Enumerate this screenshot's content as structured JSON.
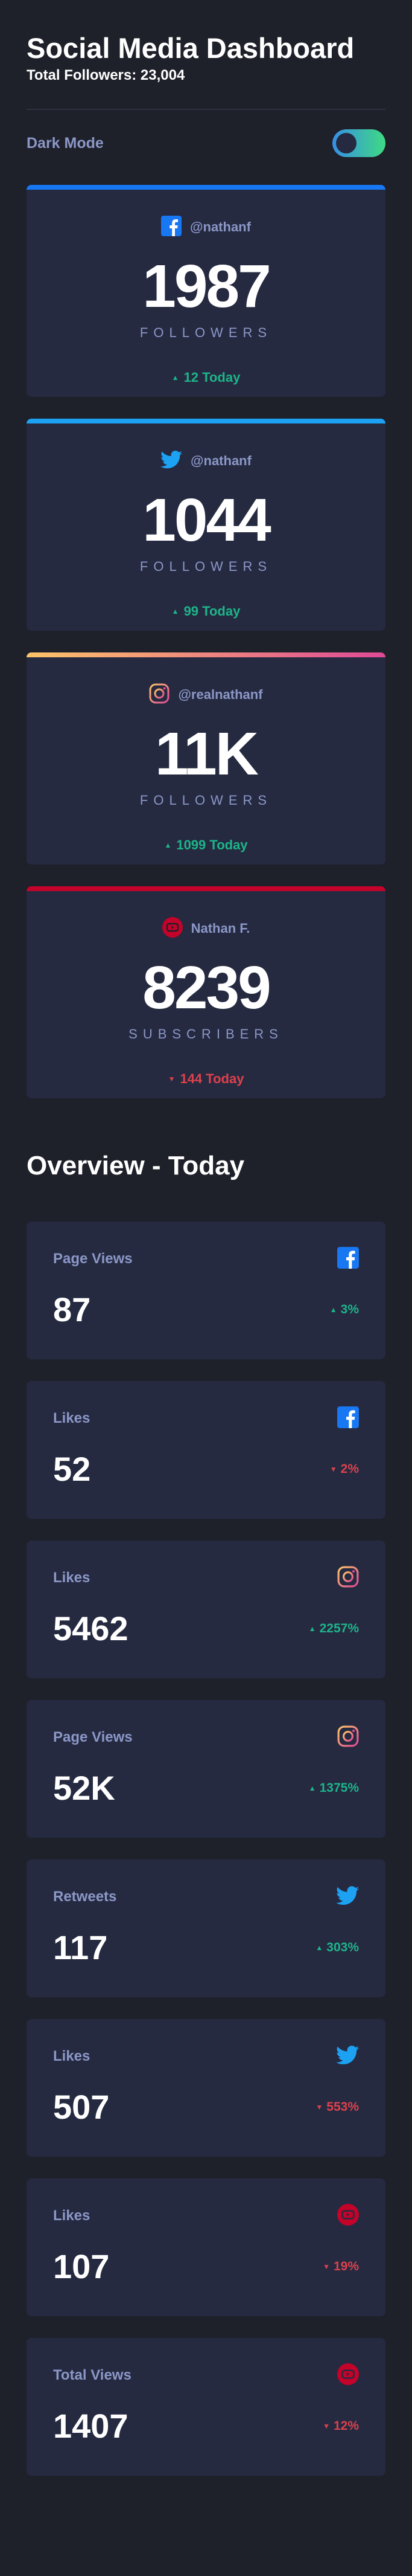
{
  "header": {
    "title": "Social Media Dashboard",
    "subtitle": "Total Followers: 23,004"
  },
  "mode": {
    "label": "Dark Mode",
    "toggle_on": true
  },
  "colors": {
    "facebook": "#1877f2",
    "twitter": "#1da1f2",
    "instagram_start": "#fdc468",
    "instagram_end": "#df4996",
    "youtube": "#c4032a",
    "up": "#1db489",
    "down": "#dc414c"
  },
  "followers": [
    {
      "network": "facebook",
      "icon": "facebook-icon",
      "handle": "@nathanf",
      "count": "1987",
      "label": "Followers",
      "change": "12 Today",
      "direction": "up"
    },
    {
      "network": "twitter",
      "icon": "twitter-icon",
      "handle": "@nathanf",
      "count": "1044",
      "label": "Followers",
      "change": "99 Today",
      "direction": "up"
    },
    {
      "network": "instagram",
      "icon": "instagram-icon",
      "handle": "@realnathanf",
      "count": "11K",
      "label": "Followers",
      "change": "1099 Today",
      "direction": "up"
    },
    {
      "network": "youtube",
      "icon": "youtube-icon",
      "handle": "Nathan F.",
      "count": "8239",
      "label": "Subscribers",
      "change": "144 Today",
      "direction": "down"
    }
  ],
  "overview": {
    "title": "Overview - Today",
    "cards": [
      {
        "label": "Page Views",
        "icon": "facebook-icon",
        "value": "87",
        "change": "3%",
        "direction": "up"
      },
      {
        "label": "Likes",
        "icon": "facebook-icon",
        "value": "52",
        "change": "2%",
        "direction": "down"
      },
      {
        "label": "Likes",
        "icon": "instagram-icon",
        "value": "5462",
        "change": "2257%",
        "direction": "up"
      },
      {
        "label": "Page Views",
        "icon": "instagram-icon",
        "value": "52K",
        "change": "1375%",
        "direction": "up"
      },
      {
        "label": "Retweets",
        "icon": "twitter-icon",
        "value": "117",
        "change": "303%",
        "direction": "up"
      },
      {
        "label": "Likes",
        "icon": "twitter-icon",
        "value": "507",
        "change": "553%",
        "direction": "up"
      },
      {
        "label": "Likes",
        "icon": "youtube-icon",
        "value": "107",
        "change": "19%",
        "direction": "down"
      },
      {
        "label": "Total Views",
        "icon": "youtube-icon",
        "value": "1407",
        "change": "12%",
        "direction": "down"
      }
    ]
  }
}
